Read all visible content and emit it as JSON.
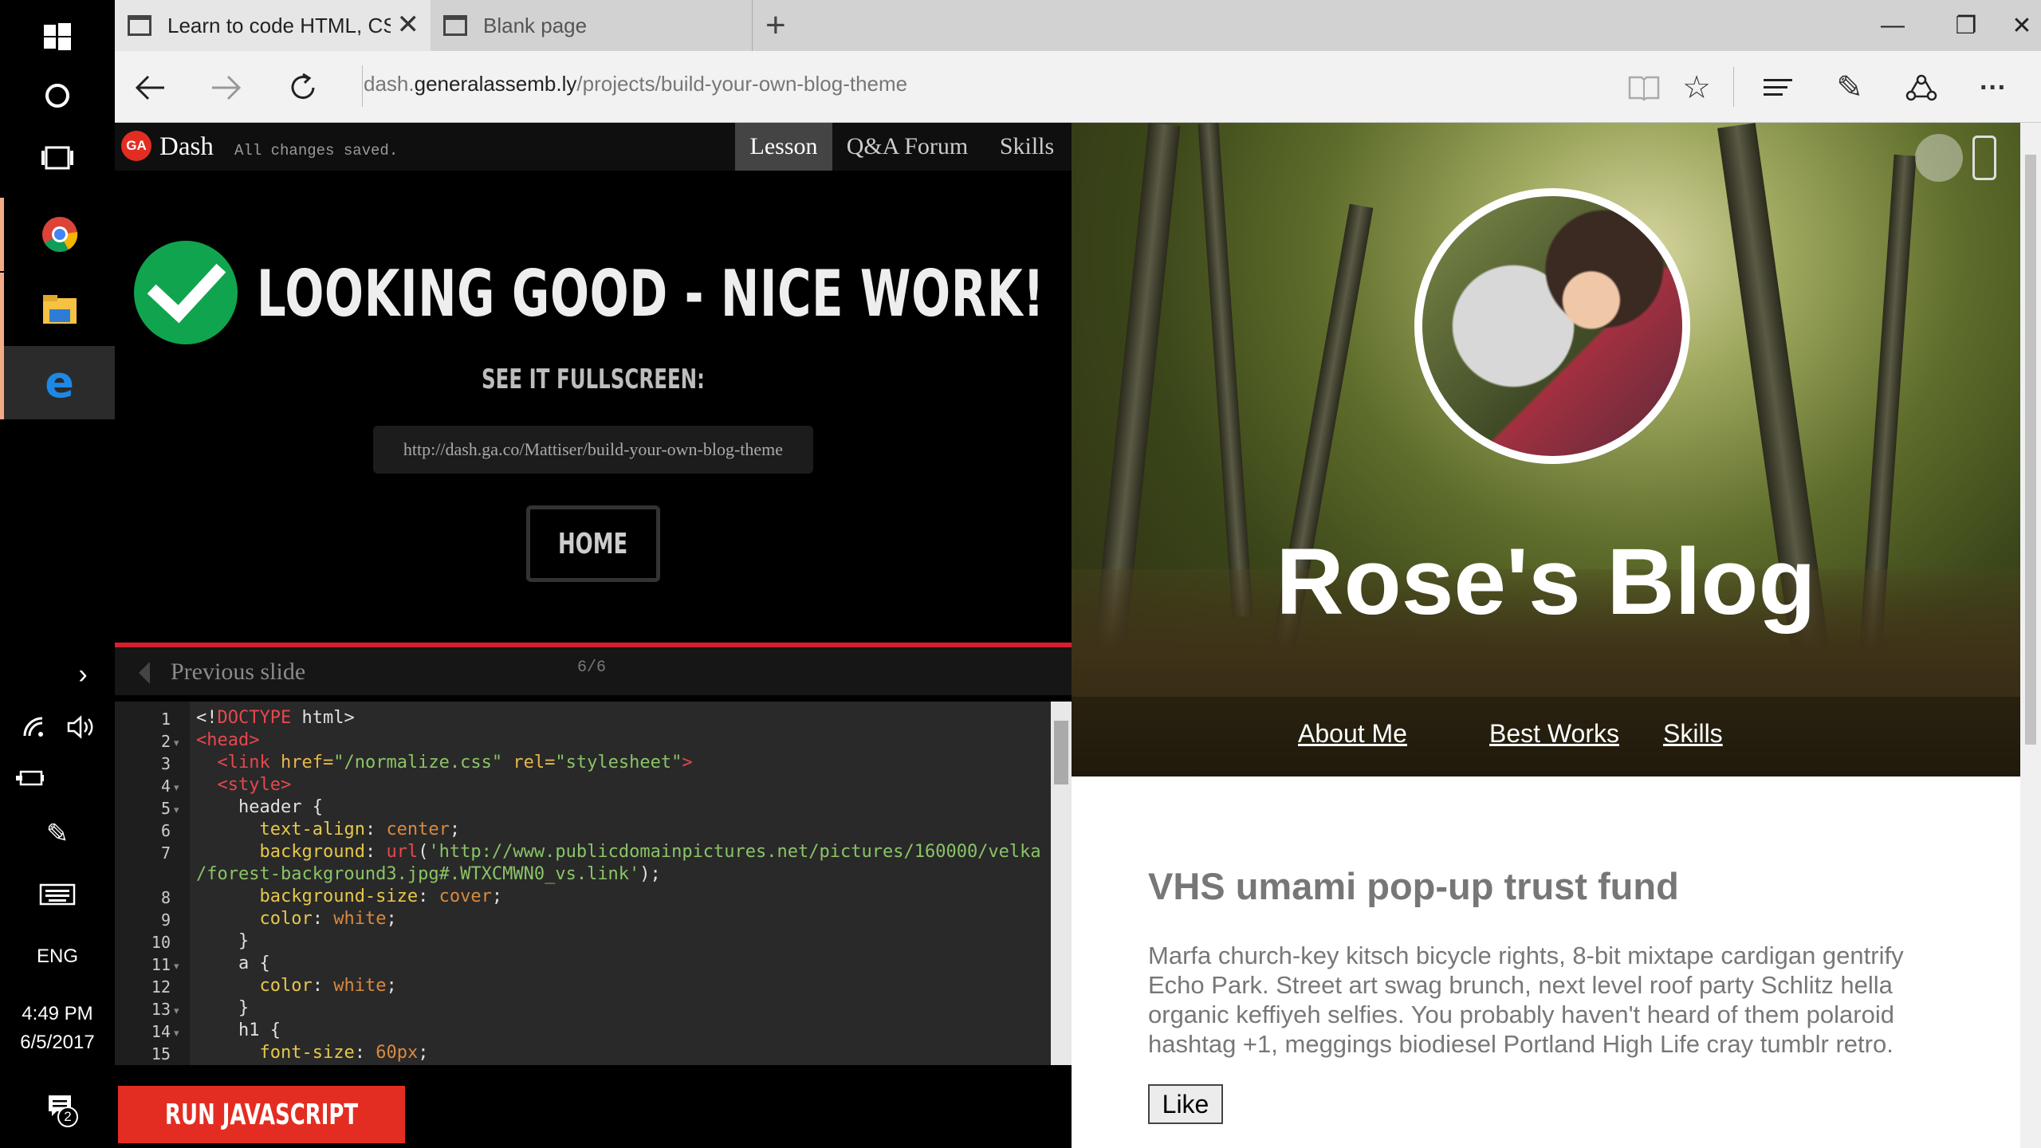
{
  "browser": {
    "tabs": [
      {
        "label": "Learn to code HTML, CS"
      },
      {
        "label": "Blank page"
      }
    ],
    "address": {
      "prefix": "dash.",
      "host": "generalassemb.ly",
      "path": "/projects/build-your-own-blog-theme"
    }
  },
  "taskbar": {
    "language": "ENG",
    "time": "4:49 PM",
    "date": "6/5/2017",
    "notification_count": "2"
  },
  "dash": {
    "logo": "GA",
    "title": "Dash",
    "status": "All changes saved.",
    "tabs": [
      "Lesson",
      "Q&A Forum",
      "Skills"
    ],
    "active_tab": "Lesson",
    "success_title": "LOOKING GOOD - NICE WORK!",
    "fullscreen_label": "SEE IT FULLSCREEN:",
    "fullscreen_url": "http://dash.ga.co/Mattiser/build-your-own-blog-theme",
    "home_label": "HOME",
    "prev_label": "Previous slide",
    "slide_count": "6/6",
    "run_label": "RUN JAVASCRIPT",
    "code_line_numbers": [
      "1",
      "2",
      "3",
      "4",
      "5",
      "6",
      "7",
      "",
      "8",
      "9",
      "10",
      "11",
      "12",
      "13",
      "14",
      "15"
    ]
  },
  "blog": {
    "title": "Rose's Blog",
    "nav": [
      "About Me",
      "Best Works",
      "Skills"
    ],
    "post_title": "VHS umami pop-up trust fund",
    "post_body": "Marfa church-key kitsch bicycle rights, 8-bit mixtape cardigan gentrify Echo Park. Street art swag brunch, next level roof party Schlitz hella organic keffiyeh selfies. You probably haven't heard of them polaroid hashtag +1, meggings biodiesel Portland High Life cray tumblr retro.",
    "like_label": "Like"
  },
  "colors": {
    "accent_red": "#e32d22",
    "success_green": "#10a44e",
    "rule_red": "#d91f2d"
  }
}
